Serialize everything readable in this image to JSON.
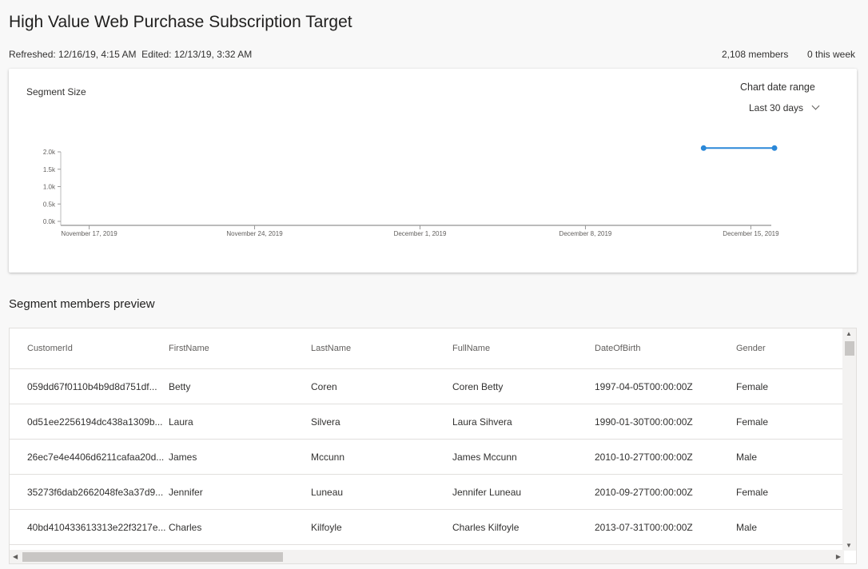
{
  "header": {
    "title": "High Value Web Purchase Subscription Target",
    "refreshed": "Refreshed: 12/16/19, 4:15 AM",
    "edited": "Edited: 12/13/19, 3:32 AM",
    "members": "2,108 members",
    "this_week": "0 this week"
  },
  "card": {
    "title": "Segment Size",
    "date_range_label": "Chart date range",
    "date_range_value": "Last 30 days"
  },
  "chart_data": {
    "type": "line",
    "title": "Segment Size",
    "x_range": [
      "2019-11-16",
      "2019-12-16"
    ],
    "ylim": [
      0,
      2000
    ],
    "yticks": [
      "0.0k",
      "0.5k",
      "1.0k",
      "1.5k",
      "2.0k"
    ],
    "xticks": [
      {
        "date": "2019-11-17",
        "label": "November 17, 2019"
      },
      {
        "date": "2019-11-24",
        "label": "November 24, 2019"
      },
      {
        "date": "2019-12-01",
        "label": "December 1, 2019"
      },
      {
        "date": "2019-12-08",
        "label": "December 8, 2019"
      },
      {
        "date": "2019-12-15",
        "label": "December 15, 2019"
      }
    ],
    "series": [
      {
        "name": "Segment size",
        "color": "#2b88d8",
        "points": [
          {
            "date": "2019-12-13",
            "value": 2108
          },
          {
            "date": "2019-12-16",
            "value": 2108
          }
        ]
      }
    ]
  },
  "preview": {
    "title": "Segment members preview",
    "columns": [
      "CustomerId",
      "FirstName",
      "LastName",
      "FullName",
      "DateOfBirth",
      "Gender"
    ],
    "rows": [
      [
        "059dd67f0110b4b9d8d751df...",
        "Betty",
        "Coren",
        "Coren Betty",
        "1997-04-05T00:00:00Z",
        "Female"
      ],
      [
        "0d51ee2256194dc438a1309b...",
        "Laura",
        "Silvera",
        "Laura Sihvera",
        "1990-01-30T00:00:00Z",
        "Female"
      ],
      [
        "26ec7e4e4406d6211cafaa20d...",
        "James",
        "Mccunn",
        "James Mccunn",
        "2010-10-27T00:00:00Z",
        "Male"
      ],
      [
        "35273f6dab2662048fe3a37d9...",
        "Jennifer",
        "Luneau",
        "Jennifer Luneau",
        "2010-09-27T00:00:00Z",
        "Female"
      ],
      [
        "40bd410433613313e22f3217e...",
        "Charles",
        "Kilfoyle",
        "Charles Kilfoyle",
        "2013-07-31T00:00:00Z",
        "Male"
      ]
    ]
  }
}
